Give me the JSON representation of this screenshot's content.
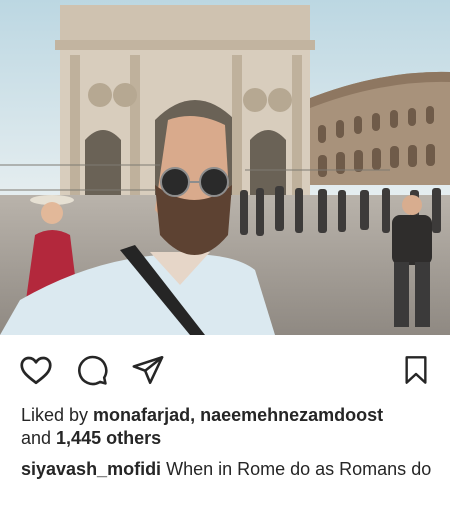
{
  "post": {
    "image_alt": "Selfie in front of the Arch of Constantine and the Colosseum",
    "likes": {
      "prefix": "Liked by ",
      "user1": "monafarjad",
      "separator": ", ",
      "user2": "naeemehnezamdoost",
      "and": "and ",
      "count": "1,445 others"
    },
    "caption": {
      "username": "siyavash_mofidi",
      "text": "When in Rome do as Romans do"
    }
  },
  "icons": {
    "like": "heart-icon",
    "comment": "comment-icon",
    "share": "share-icon",
    "save": "bookmark-icon"
  },
  "colors": {
    "text": "#262626",
    "background": "#ffffff"
  }
}
